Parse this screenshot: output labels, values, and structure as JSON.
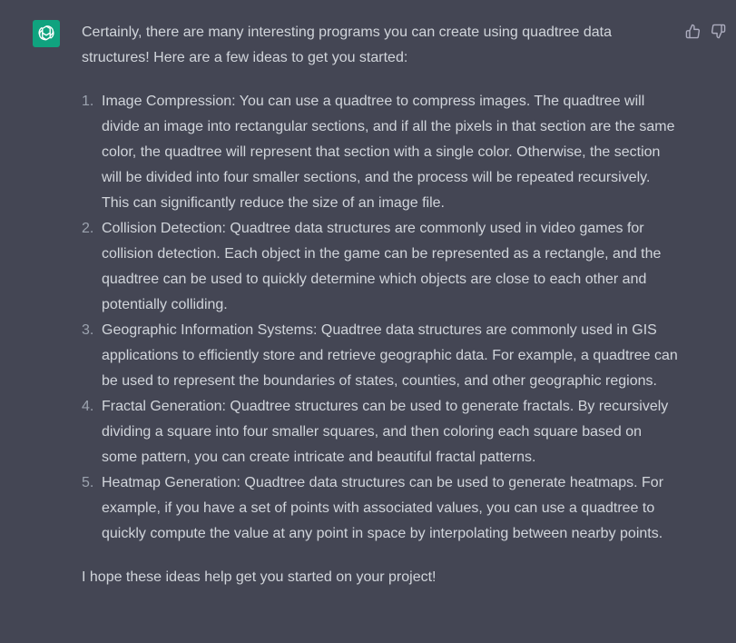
{
  "message": {
    "intro": "Certainly, there are many interesting programs you can create using quadtree data structures! Here are a few ideas to get you started:",
    "items": [
      {
        "number": "1.",
        "text": "Image Compression: You can use a quadtree to compress images. The quadtree will divide an image into rectangular sections, and if all the pixels in that section are the same color, the quadtree will represent that section with a single color. Otherwise, the section will be divided into four smaller sections, and the process will be repeated recursively. This can significantly reduce the size of an image file."
      },
      {
        "number": "2.",
        "text": "Collision Detection: Quadtree data structures are commonly used in video games for collision detection. Each object in the game can be represented as a rectangle, and the quadtree can be used to quickly determine which objects are close to each other and potentially colliding."
      },
      {
        "number": "3.",
        "text": "Geographic Information Systems: Quadtree data structures are commonly used in GIS applications to efficiently store and retrieve geographic data. For example, a quadtree can be used to represent the boundaries of states, counties, and other geographic regions."
      },
      {
        "number": "4.",
        "text": "Fractal Generation: Quadtree structures can be used to generate fractals. By recursively dividing a square into four smaller squares, and then coloring each square based on some pattern, you can create intricate and beautiful fractal patterns."
      },
      {
        "number": "5.",
        "text": "Heatmap Generation: Quadtree data structures can be used to generate heatmaps. For example, if you have a set of points with associated values, you can use a quadtree to quickly compute the value at any point in space by interpolating between nearby points."
      }
    ],
    "outro": "I hope these ideas help get you started on your project!"
  },
  "icons": {
    "avatar": "openai-logo-icon",
    "thumbs_up": "thumbs-up-icon",
    "thumbs_down": "thumbs-down-icon"
  },
  "colors": {
    "background": "#444654",
    "avatar_bg": "#10a37f",
    "text": "#d1d5db",
    "muted": "#9ca3af"
  }
}
